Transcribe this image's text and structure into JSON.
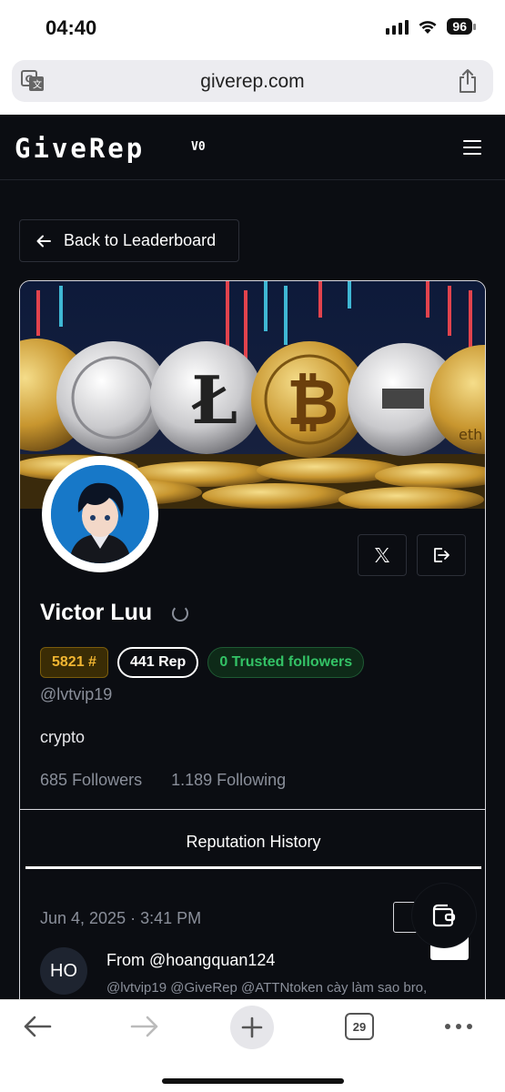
{
  "status_bar": {
    "time": "04:40",
    "battery": "96"
  },
  "browser": {
    "url": "giverep.com",
    "tab_count": "29"
  },
  "app": {
    "logo": "GiveRep",
    "version": "V0",
    "back_button": "Back to Leaderboard",
    "profile": {
      "name": "Victor Luu",
      "rank_badge": "5821 #",
      "rep_badge": "441 Rep",
      "trusted_badge": "0 Trusted followers",
      "handle": "@lvtvip19",
      "bio": "crypto",
      "followers_count": "685",
      "followers_label": "Followers",
      "following_count": "1.189",
      "following_label": "Following"
    },
    "tabs": {
      "active": "Reputation History"
    },
    "history": [
      {
        "date": "Jun 4, 2025 · 3:41 PM",
        "avatar_initials": "HO",
        "from": "From @hoangquan124",
        "text": "@lvtvip19 @GiveRep @ATTNtoken cày làm sao bro,"
      }
    ]
  },
  "colors": {
    "app_bg": "#0b0d12",
    "rank_gold": "#f2b632",
    "trusted_green": "#33c266",
    "muted_text": "#8a8f9a"
  },
  "icons": [
    "translate-icon",
    "share-icon",
    "hamburger-icon",
    "arrow-left-icon",
    "x-logo-icon",
    "logout-icon",
    "spinner-icon",
    "wallet-icon",
    "back-icon",
    "forward-icon",
    "plus-icon",
    "tabs-icon",
    "more-icon"
  ]
}
